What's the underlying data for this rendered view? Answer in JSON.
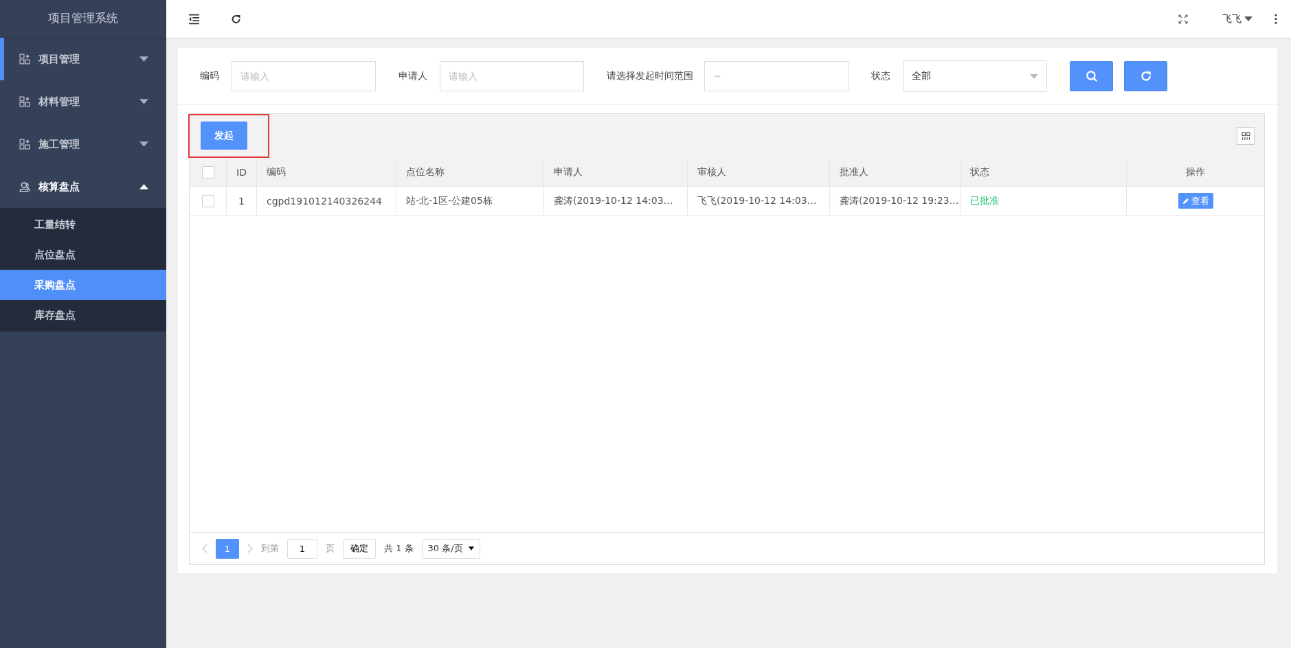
{
  "sidebar": {
    "title": "项目管理系统",
    "menu": [
      {
        "label": "项目管理",
        "kind": "grid",
        "expanded": false,
        "active": true
      },
      {
        "label": "材料管理",
        "kind": "grid",
        "expanded": false,
        "active": false
      },
      {
        "label": "施工管理",
        "kind": "grid",
        "expanded": false,
        "active": false
      },
      {
        "label": "核算盘点",
        "kind": "user",
        "expanded": true,
        "active": false,
        "children": [
          {
            "label": "工量结转",
            "selected": false
          },
          {
            "label": "点位盘点",
            "selected": false
          },
          {
            "label": "采购盘点",
            "selected": true
          },
          {
            "label": "库存盘点",
            "selected": false
          }
        ]
      }
    ]
  },
  "header": {
    "user": "飞飞"
  },
  "filters": [
    {
      "kind": "input",
      "label": "编码",
      "placeholder": "请输入"
    },
    {
      "kind": "input",
      "label": "申请人",
      "placeholder": "请输入"
    },
    {
      "kind": "range",
      "label": "请选择发起时间范围",
      "placeholder": "~"
    },
    {
      "kind": "select",
      "label": "状态",
      "value": "全部"
    }
  ],
  "toolbar": {
    "primary_button": "发起",
    "highlighted": true
  },
  "table": {
    "all_checked": false,
    "columns": [
      "ID",
      "编码",
      "点位名称",
      "申请人",
      "审核人",
      "批准人",
      "状态",
      "操作"
    ],
    "rows": [
      {
        "checked": false,
        "cells": [
          "1",
          "cgpd191012140326244",
          "站-北-1区-公建05栋",
          "龚涛(2019-10-12 14:03…",
          "飞飞(2019-10-12 14:03…",
          "龚涛(2019-10-12 19:23…"
        ],
        "status": {
          "text": "已批准",
          "color": "#19be6b"
        },
        "action": "查看"
      }
    ]
  },
  "pagination": {
    "pages": [
      {
        "label": "1",
        "selected": true
      }
    ],
    "goto_label": "到第",
    "goto_value": "1",
    "page_unit": "页",
    "confirm": "确定",
    "total": "共 1 条",
    "page_size": "30 条/页"
  }
}
